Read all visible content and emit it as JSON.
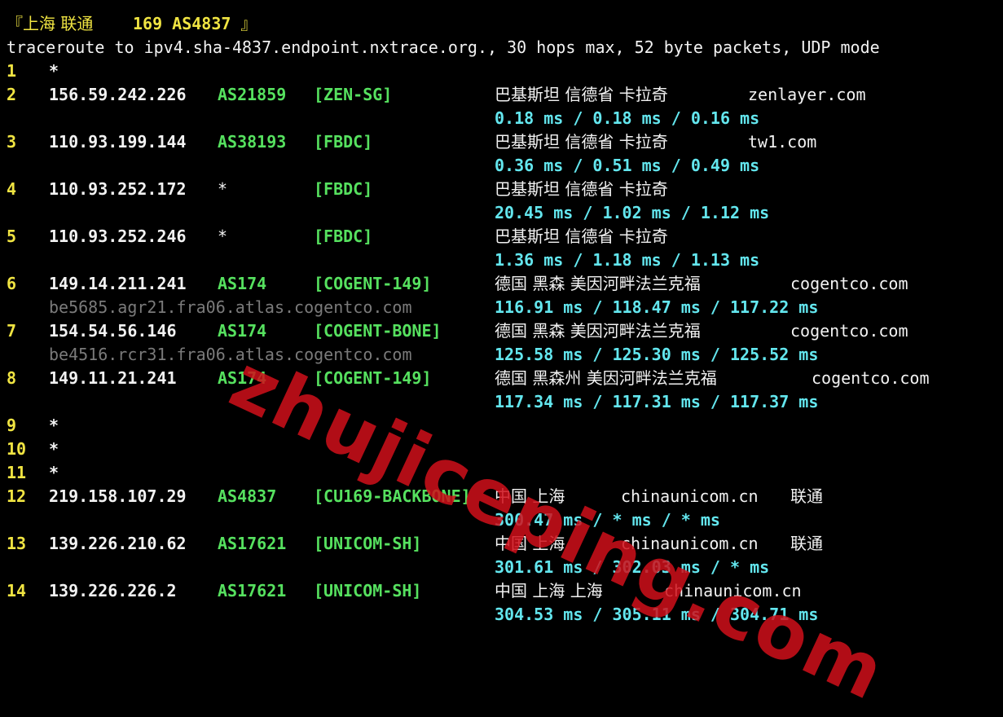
{
  "header": {
    "title_open": "『上海 联通 ",
    "title_num": "169 AS4837",
    "title_close": " 』"
  },
  "command_line": "traceroute to ipv4.sha-4837.endpoint.nxtrace.org., 30 hops max, 52 byte packets, UDP mode",
  "hops": [
    {
      "num": "1",
      "ip": "*"
    },
    {
      "num": "2",
      "ip": "156.59.242.226",
      "asn": "AS21859",
      "tag": "[ZEN-SG]",
      "geo": "巴基斯坦 信德省 卡拉奇",
      "domain": "zenlayer.com",
      "rtt": "0.18 ms / 0.18 ms / 0.16 ms"
    },
    {
      "num": "3",
      "ip": "110.93.199.144",
      "asn": "AS38193",
      "tag": "[FBDC]",
      "geo": "巴基斯坦 信德省 卡拉奇",
      "domain": "tw1.com",
      "rtt": "0.36 ms / 0.51 ms / 0.49 ms"
    },
    {
      "num": "4",
      "ip": "110.93.252.172",
      "asn": "*",
      "tag": "[FBDC]",
      "geo": "巴基斯坦 信德省 卡拉奇",
      "rtt": "20.45 ms / 1.02 ms / 1.12 ms"
    },
    {
      "num": "5",
      "ip": "110.93.252.246",
      "asn": "*",
      "tag": "[FBDC]",
      "geo": "巴基斯坦 信德省 卡拉奇",
      "rtt": "1.36 ms / 1.18 ms / 1.13 ms"
    },
    {
      "num": "6",
      "ip": "149.14.211.241",
      "asn": "AS174",
      "tag": "[COGENT-149]",
      "geo": "德国 黑森 美因河畔法兰克福",
      "domain": "cogentco.com",
      "host": "be5685.agr21.fra06.atlas.cogentco.com",
      "rtt": "116.91 ms / 118.47 ms / 117.22 ms"
    },
    {
      "num": "7",
      "ip": "154.54.56.146",
      "asn": "AS174",
      "tag": "[COGENT-BONE]",
      "geo": "德国 黑森 美因河畔法兰克福",
      "domain": "cogentco.com",
      "host": "be4516.rcr31.fra06.atlas.cogentco.com",
      "rtt": "125.58 ms / 125.30 ms / 125.52 ms"
    },
    {
      "num": "8",
      "ip": "149.11.21.241",
      "asn": "AS174",
      "tag": "[COGENT-149]",
      "geo": "德国 黑森州 美因河畔法兰克福",
      "domain": "cogentco.com",
      "rtt": "117.34 ms / 117.31 ms / 117.37 ms"
    },
    {
      "num": "9",
      "ip": "*"
    },
    {
      "num": "10",
      "ip": "*"
    },
    {
      "num": "11",
      "ip": "*"
    },
    {
      "num": "12",
      "ip": "219.158.107.29",
      "asn": "AS4837",
      "tag": "[CU169-BACKBONE]",
      "geo": "中国 上海",
      "domain": "chinaunicom.cn",
      "isp": "联通",
      "rtt": "300.47 ms / * ms / * ms"
    },
    {
      "num": "13",
      "ip": "139.226.210.62",
      "asn": "AS17621",
      "tag": "[UNICOM-SH]",
      "geo": "中国 上海",
      "domain": "chinaunicom.cn",
      "isp": "联通",
      "rtt": "301.61 ms / 302.03 ms / * ms"
    },
    {
      "num": "14",
      "ip": "139.226.226.2",
      "asn": "AS17621",
      "tag": "[UNICOM-SH]",
      "geo": "中国 上海 上海",
      "domain": "chinaunicom.cn",
      "rtt": "304.53 ms / 305.11 ms / 304.71 ms"
    }
  ],
  "watermark": "zhujiceping.com",
  "colors": {
    "background": "#000000",
    "hop_number": "#f0e442",
    "ip": "#f2f2f2",
    "asn_tag": "#56e15f",
    "rtt": "#63e6ee",
    "hostname": "#7a7a7a",
    "watermark": "#d0101a"
  }
}
